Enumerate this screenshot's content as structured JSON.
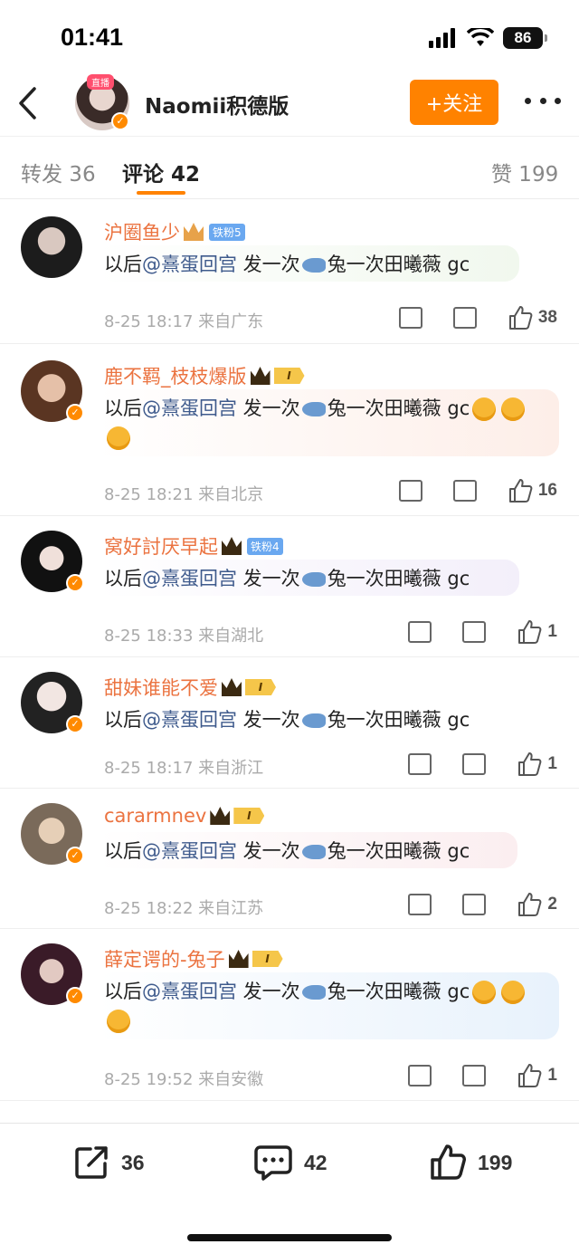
{
  "status": {
    "time": "01:41",
    "battery": "86"
  },
  "header": {
    "title": "Naomii积德版",
    "follow_label": "+关注",
    "live_tag": "直播"
  },
  "tabs": {
    "repost": "转发 36",
    "comment": "评论 42",
    "like": "赞 199"
  },
  "comments": [
    {
      "name": "沪圈鱼少",
      "badge": "铁粉5",
      "pre": "以后",
      "mention": "@熹蛋回宫",
      "post": " 发一次",
      "post2": "兔一次田曦薇 gc",
      "meta": "8-25 18:17 来自广东",
      "likes": "38"
    },
    {
      "name": "鹿不羁_枝枝爆版",
      "badge": "I",
      "pre": "以后",
      "mention": "@熹蛋回宫",
      "post": " 发一次",
      "post2": "兔一次田曦薇 gc",
      "meta": "8-25 18:21 来自北京",
      "likes": "16"
    },
    {
      "name": "窝好討厌早起",
      "badge": "铁粉4",
      "pre": "以后",
      "mention": "@熹蛋回宫",
      "post": " 发一次",
      "post2": "兔一次田曦薇 gc",
      "meta": "8-25 18:33 来自湖北",
      "likes": "1"
    },
    {
      "name": "甜妹谁能不爱",
      "badge": "I",
      "pre": "以后",
      "mention": "@熹蛋回宫",
      "post": " 发一次",
      "post2": "兔一次田曦薇 gc",
      "meta": "8-25 18:17 来自浙江",
      "likes": "1"
    },
    {
      "name": "cararmnev",
      "badge": "I",
      "pre": "以后",
      "mention": "@熹蛋回宫",
      "post": " 发一次",
      "post2": "兔一次田曦薇 gc",
      "meta": "8-25 18:22 来自江苏",
      "likes": "2"
    },
    {
      "name": "薛定谔的-兔子",
      "badge": "I",
      "pre": "以后",
      "mention": "@熹蛋回宫",
      "post": " 发一次",
      "post2": "兔一次田曦薇 gc",
      "meta": "8-25 19:52 来自安徽",
      "likes": "1"
    }
  ],
  "bottom": {
    "repost": "36",
    "comment": "42",
    "like": "199"
  },
  "colors": {
    "accent": "#ff8200",
    "name": "#eb7340",
    "mention": "#3e5a8c"
  }
}
